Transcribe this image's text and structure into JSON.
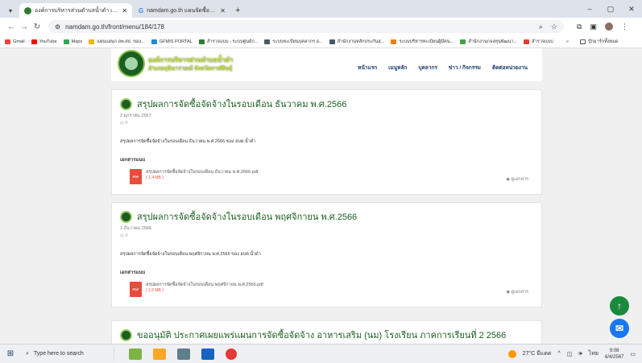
{
  "browser": {
    "tabs": [
      {
        "title": "องค์การบริหารส่วนตำบลน้ำดำ เทศบ",
        "active": true
      },
      {
        "title": "namdam.go.th แผนจัดซื้อจัดจ้าง",
        "active": false
      }
    ],
    "tab_close": "✕",
    "new_tab": "+",
    "url": "namdam.go.th/front/menu/184/178",
    "window_controls": {
      "minimize": "–",
      "maximize": "▢",
      "close": "✕"
    },
    "bookmarks": [
      "Gmail",
      "YouTube",
      "Maps",
      "แผนแผนก อพ.สธ. ของ...",
      "GFMIS PORTAL",
      "สำรวจแบบ - ระบบศูนย์ก...",
      "ระบบทะเบียนบุคลากร อ...",
      "สำนักงานหลักประกันสุ...",
      "ระบบบริหารทะเบียนผู้มีคน...",
      "สำนักงานกองทุนพัฒนา...",
      "สำรวจแบบ"
    ],
    "bookmarks_more": "»",
    "all_bookmarks": "บุ๊กมาร์กทั้งหมด"
  },
  "site": {
    "name": "องค์การบริหารส่วนตำบลน้ำดำ",
    "sub": "อำเภอกุฉินารายณ์ จังหวัดกาฬสินธุ์",
    "nav": [
      "หน้าแรก",
      "เมนูหลัก",
      "บุคลากร",
      "ข่าว / กิจกรรม",
      "ติดต่อหน่วยงาน"
    ]
  },
  "posts": [
    {
      "title": "สรุปผลการจัดซื้อจัดจ้างในรอบเดือน ธันวาคม พ.ศ.2566",
      "date": "2 มกราคม 2567",
      "views": "◎ 0",
      "desc": "สรุปผลการจัดซื้อจัดจ้างในรอบเดือน ธันวาคม พ.ศ.2566 ของ อบต.น้ำดำ",
      "attach_label": "เอกสารแนบ",
      "file": "สรุปผลการจัดซื้อจัดจ้างในรอบเดือน ธันวาคม พ.ศ.2566.pdf",
      "size": "( 1.4 MB )",
      "view_doc": "◉ ดูเอกสาร"
    },
    {
      "title": "สรุปผลการจัดซื้อจัดจ้างในรอบเดือน พฤศจิกายน พ.ศ.2566",
      "date": "1 ธันวาคม 2566",
      "views": "◎ 0",
      "desc": "สรุปผลการจัดซื้อจัดจ้างในรอบเดือน พฤศจิกายน พ.ศ.2566 ของ อบต.น้ำดำ",
      "attach_label": "เอกสารแนบ",
      "file": "สรุปผลการจัดซื้อจัดจ้างในรอบเดือน พฤศจิกายน พ.ศ.2566.pdf",
      "size": "( 1.6 MB )",
      "view_doc": "◉ ดูเอกสาร"
    },
    {
      "title": "ขออนุมัติ ประกาศเผยแพร่แผนการจัดซื้อจัดจ้าง อาหารเสริม (นม) โรงเรียน ภาคการเรียนที่ 2 2566"
    }
  ],
  "pdf_label": "PDF",
  "fab": {
    "up": "↑",
    "messenger": "✉"
  },
  "taskbar": {
    "search_placeholder": "Type here to search",
    "weather": "27°C มีแดด",
    "lang": "ไทย",
    "time": "9:08",
    "date": "6/4/2567"
  }
}
